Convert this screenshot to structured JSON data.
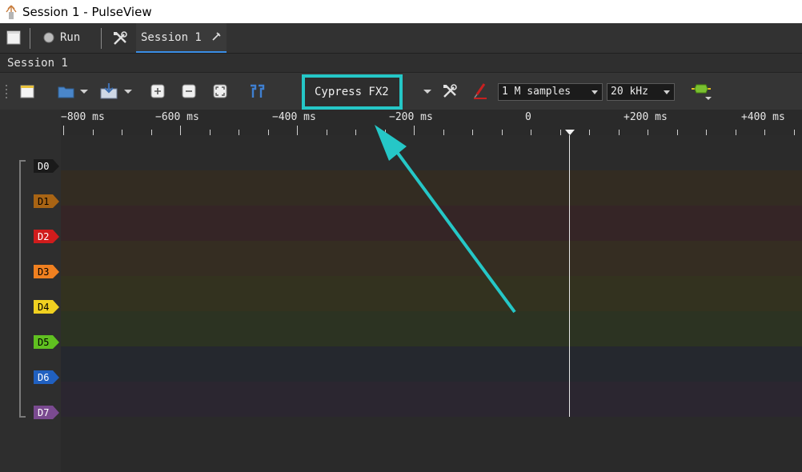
{
  "window": {
    "title": "Session 1 - PulseView"
  },
  "tabbar": {
    "run_label": "Run",
    "tab_label": "Session 1"
  },
  "session": {
    "label": "Session 1"
  },
  "toolbar": {
    "device": "Cypress FX2",
    "samples": "1 M samples",
    "samplerate": "20 kHz"
  },
  "ruler": {
    "labels": [
      "−800 ms",
      "−600 ms",
      "−400 ms",
      "−200 ms",
      "0",
      "+200 ms",
      "+400 ms"
    ]
  },
  "channels": [
    {
      "name": "D0",
      "color": "#1a1a1a",
      "lane": "#2b2b2b"
    },
    {
      "name": "D1",
      "color": "#a86414",
      "lane": "#332c22"
    },
    {
      "name": "D2",
      "color": "#d01c1c",
      "lane": "#352526"
    },
    {
      "name": "D3",
      "color": "#f08020",
      "lane": "#352d22"
    },
    {
      "name": "D4",
      "color": "#f0d020",
      "lane": "#33321f"
    },
    {
      "name": "D5",
      "color": "#60c020",
      "lane": "#2c3322"
    },
    {
      "name": "D6",
      "color": "#2060c0",
      "lane": "#25282e"
    },
    {
      "name": "D7",
      "color": "#7a4a90",
      "lane": "#2b2630"
    }
  ],
  "accent": {
    "highlight": "#25c7c7"
  }
}
